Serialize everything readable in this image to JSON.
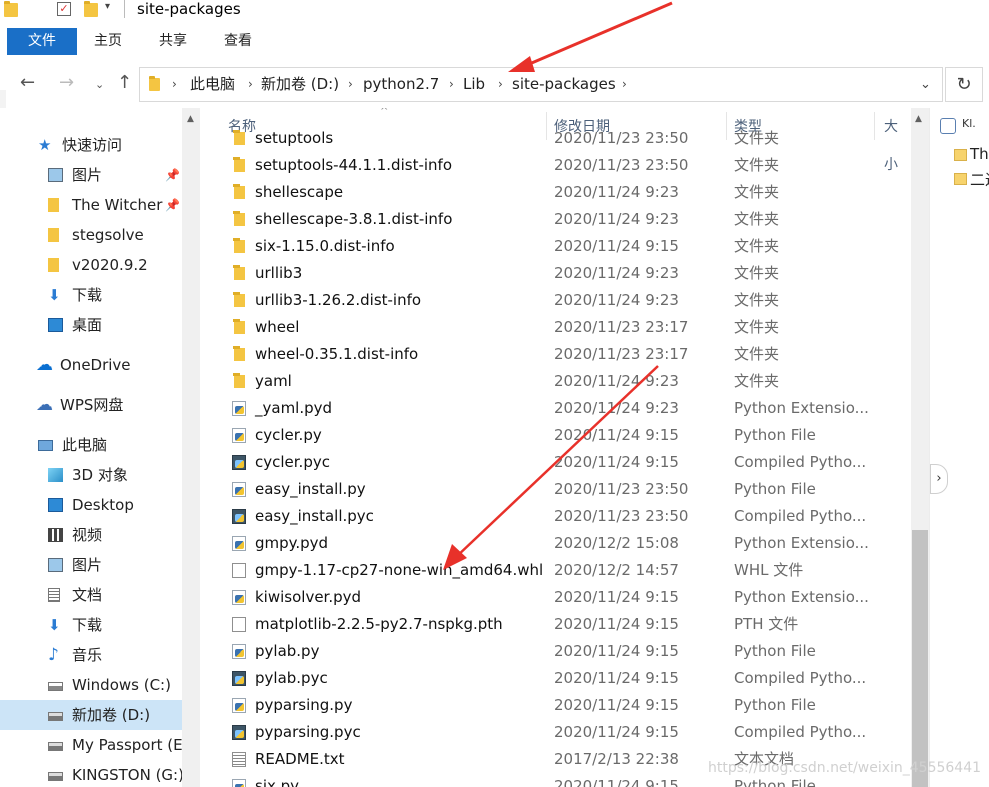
{
  "window": {
    "title": "site-packages"
  },
  "ribbon": {
    "tabs": [
      "文件",
      "主页",
      "共享",
      "查看"
    ]
  },
  "address": {
    "crumbs": [
      "此电脑",
      "新加卷 (D:)",
      "python2.7",
      "Lib",
      "site-packages"
    ]
  },
  "nav_pane": {
    "items": [
      {
        "label": "快速访问",
        "icon": "star-icon",
        "pinned": false
      },
      {
        "label": "图片",
        "icon": "pictures-icon",
        "pinned": true
      },
      {
        "label": "The Witcher",
        "icon": "folder-icon",
        "pinned": true
      },
      {
        "label": "stegsolve",
        "icon": "folder-icon",
        "pinned": false
      },
      {
        "label": "v2020.9.2",
        "icon": "folder-icon",
        "pinned": false
      },
      {
        "label": "下载",
        "icon": "download-icon",
        "pinned": false
      },
      {
        "label": "桌面",
        "icon": "desktop-icon",
        "pinned": false
      },
      {
        "label": "OneDrive",
        "icon": "cloud-icon",
        "pinned": false
      },
      {
        "label": "WPS网盘",
        "icon": "wps-cloud-icon",
        "pinned": false
      },
      {
        "label": "此电脑",
        "icon": "computer-icon",
        "pinned": false
      },
      {
        "label": "3D 对象",
        "icon": "cube-icon",
        "pinned": false
      },
      {
        "label": "Desktop",
        "icon": "desktop-icon",
        "pinned": false
      },
      {
        "label": "视频",
        "icon": "video-icon",
        "pinned": false
      },
      {
        "label": "图片",
        "icon": "pictures-icon",
        "pinned": false
      },
      {
        "label": "文档",
        "icon": "document-icon",
        "pinned": false
      },
      {
        "label": "下载",
        "icon": "download-icon",
        "pinned": false
      },
      {
        "label": "音乐",
        "icon": "music-icon",
        "pinned": false
      },
      {
        "label": "Windows (C:)",
        "icon": "drive-windows-icon",
        "pinned": false
      },
      {
        "label": "新加卷 (D:)",
        "icon": "drive-icon",
        "pinned": false
      },
      {
        "label": "My Passport (E:",
        "icon": "drive-icon",
        "pinned": false
      },
      {
        "label": "KINGSTON (G:)",
        "icon": "drive-icon",
        "pinned": false
      }
    ]
  },
  "columns": {
    "name": "名称",
    "date": "修改日期",
    "type": "类型",
    "size": "大小"
  },
  "files": [
    {
      "name": "setuptools",
      "date": "2020/11/23 23:50",
      "type": "文件夹",
      "icon": "folder"
    },
    {
      "name": "setuptools-44.1.1.dist-info",
      "date": "2020/11/23 23:50",
      "type": "文件夹",
      "icon": "folder"
    },
    {
      "name": "shellescape",
      "date": "2020/11/24 9:23",
      "type": "文件夹",
      "icon": "folder"
    },
    {
      "name": "shellescape-3.8.1.dist-info",
      "date": "2020/11/24 9:23",
      "type": "文件夹",
      "icon": "folder"
    },
    {
      "name": "six-1.15.0.dist-info",
      "date": "2020/11/24 9:15",
      "type": "文件夹",
      "icon": "folder"
    },
    {
      "name": "urllib3",
      "date": "2020/11/24 9:23",
      "type": "文件夹",
      "icon": "folder"
    },
    {
      "name": "urllib3-1.26.2.dist-info",
      "date": "2020/11/24 9:23",
      "type": "文件夹",
      "icon": "folder"
    },
    {
      "name": "wheel",
      "date": "2020/11/23 23:17",
      "type": "文件夹",
      "icon": "folder"
    },
    {
      "name": "wheel-0.35.1.dist-info",
      "date": "2020/11/23 23:17",
      "type": "文件夹",
      "icon": "folder"
    },
    {
      "name": "yaml",
      "date": "2020/11/24 9:23",
      "type": "文件夹",
      "icon": "folder"
    },
    {
      "name": "_yaml.pyd",
      "date": "2020/11/24 9:23",
      "type": "Python Extensio...",
      "icon": "py"
    },
    {
      "name": "cycler.py",
      "date": "2020/11/24 9:15",
      "type": "Python File",
      "icon": "py"
    },
    {
      "name": "cycler.pyc",
      "date": "2020/11/24 9:15",
      "type": "Compiled Pytho...",
      "icon": "pyc"
    },
    {
      "name": "easy_install.py",
      "date": "2020/11/23 23:50",
      "type": "Python File",
      "icon": "py"
    },
    {
      "name": "easy_install.pyc",
      "date": "2020/11/23 23:50",
      "type": "Compiled Pytho...",
      "icon": "pyc"
    },
    {
      "name": "gmpy.pyd",
      "date": "2020/12/2 15:08",
      "type": "Python Extensio...",
      "icon": "py"
    },
    {
      "name": "gmpy-1.17-cp27-none-win_amd64.whl",
      "date": "2020/12/2 14:57",
      "type": "WHL 文件",
      "icon": "blank"
    },
    {
      "name": "kiwisolver.pyd",
      "date": "2020/11/24 9:15",
      "type": "Python Extensio...",
      "icon": "py"
    },
    {
      "name": "matplotlib-2.2.5-py2.7-nspkg.pth",
      "date": "2020/11/24 9:15",
      "type": "PTH 文件",
      "icon": "blank"
    },
    {
      "name": "pylab.py",
      "date": "2020/11/24 9:15",
      "type": "Python File",
      "icon": "py"
    },
    {
      "name": "pylab.pyc",
      "date": "2020/11/24 9:15",
      "type": "Compiled Pytho...",
      "icon": "pyc"
    },
    {
      "name": "pyparsing.py",
      "date": "2020/11/24 9:15",
      "type": "Python File",
      "icon": "py"
    },
    {
      "name": "pyparsing.pyc",
      "date": "2020/11/24 9:15",
      "type": "Compiled Pytho...",
      "icon": "pyc"
    },
    {
      "name": "README.txt",
      "date": "2017/2/13 22:38",
      "type": "文本文档",
      "icon": "txt"
    },
    {
      "name": "six.py",
      "date": "2020/11/24 9:15",
      "type": "Python File",
      "icon": "py"
    }
  ],
  "right_window": {
    "items": [
      "Thu",
      "二进"
    ],
    "top_label": "Kl."
  },
  "watermark": "https://blog.csdn.net/weixin_45556441",
  "colors": {
    "accent": "#1a6fc7",
    "selected": "#cce4f7",
    "annotation": "#e8312a"
  }
}
